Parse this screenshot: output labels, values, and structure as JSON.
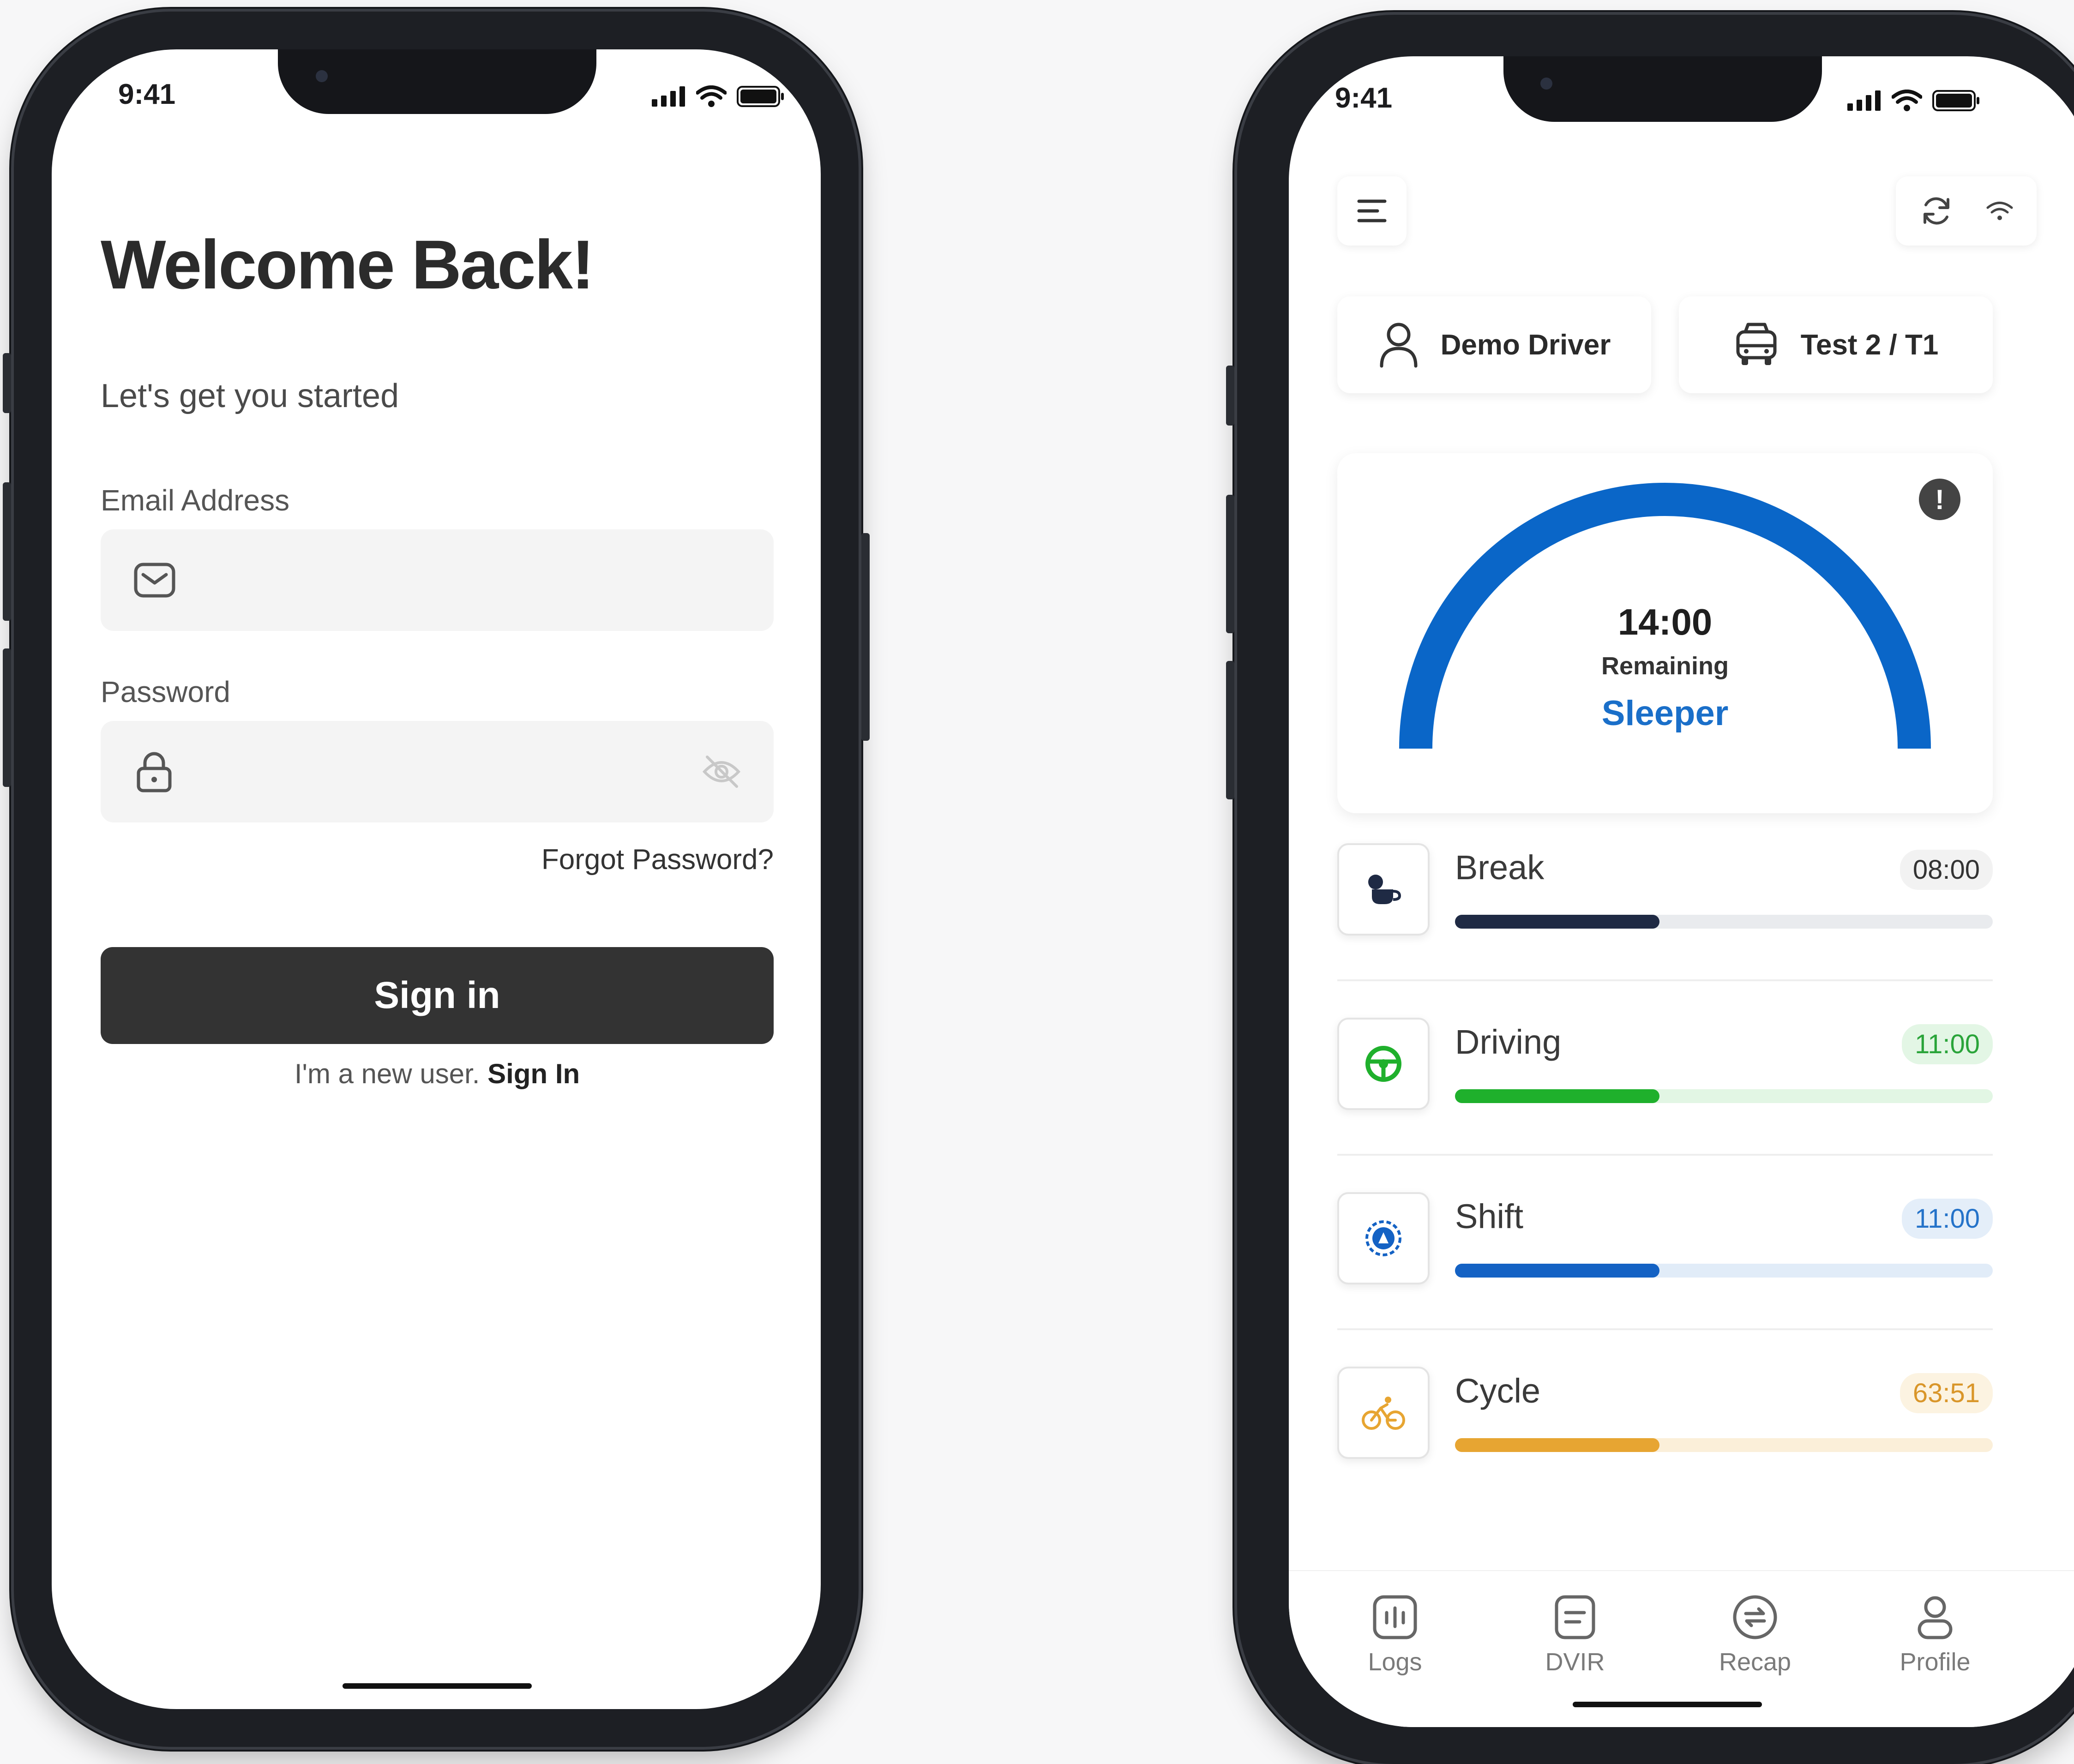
{
  "status_bar": {
    "time": "9:41"
  },
  "login": {
    "title": "Welcome Back!",
    "subtitle": "Let's get you started",
    "email_label": "Email Address",
    "email_value": "",
    "password_label": "Password",
    "password_value": "",
    "forgot_password": "Forgot Password?",
    "sign_in_button": "Sign in",
    "new_user_text": "I'm a new user.",
    "new_user_link": "Sign In"
  },
  "dashboard": {
    "driver_name": "Demo Driver",
    "vehicle": "Test 2 / T1",
    "gauge": {
      "time": "14:00",
      "remaining_label": "Remaining",
      "status": "Sleeper",
      "accent": "#0a66c8"
    },
    "stats": [
      {
        "label": "Break",
        "value": "08:00",
        "progress": 0.38,
        "color": "#1f2a44",
        "track": "#e9ebee",
        "badge_bg": "#f2f2f2",
        "badge_fg": "#333333",
        "icon": "coffee-cup-icon"
      },
      {
        "label": "Driving",
        "value": "11:00",
        "progress": 0.38,
        "color": "#1fb02c",
        "track": "#e2f6e4",
        "badge_bg": "#e3f6e5",
        "badge_fg": "#2aa43a",
        "icon": "steering-wheel-icon"
      },
      {
        "label": "Shift",
        "value": "11:00",
        "progress": 0.38,
        "color": "#1462c4",
        "track": "#e1ecf8",
        "badge_bg": "#e4eef9",
        "badge_fg": "#2573c9",
        "icon": "shift-clock-icon"
      },
      {
        "label": "Cycle",
        "value": "63:51",
        "progress": 0.38,
        "color": "#e7a532",
        "track": "#fbefd9",
        "badge_bg": "#fcf3e1",
        "badge_fg": "#d9962a",
        "icon": "bicycle-icon"
      }
    ],
    "tabs": [
      {
        "label": "Logs",
        "icon": "logs-icon"
      },
      {
        "label": "DVIR",
        "icon": "dvir-icon"
      },
      {
        "label": "Recap",
        "icon": "recap-icon"
      },
      {
        "label": "Profile",
        "icon": "profile-icon"
      }
    ]
  }
}
